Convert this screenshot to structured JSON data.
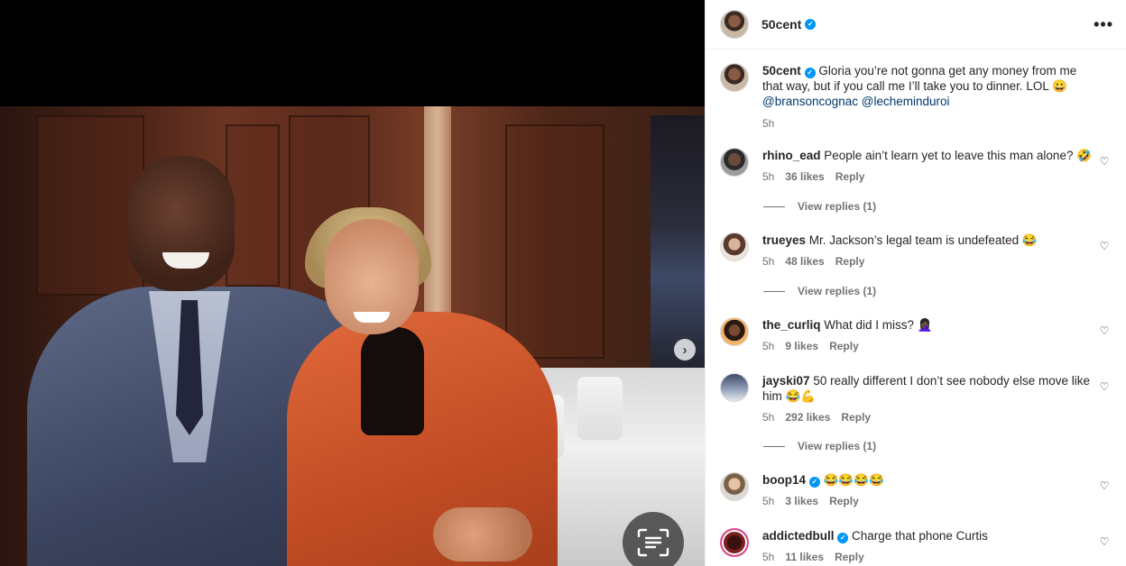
{
  "post": {
    "username": "50cent",
    "verified": true,
    "more_icon": "•••"
  },
  "media": {
    "next_icon": "›",
    "scan_icon": "visual-search-icon"
  },
  "caption": {
    "username": "50cent",
    "text": "Gloria you’re not gonna get any money from me that way, but if you call me I’ll take you to dinner. LOL 😀",
    "mentions": "@bransoncognac @lecheminduroi",
    "time": "5h"
  },
  "comments": [
    {
      "username": "rhino_ead",
      "verified": false,
      "text": "People ain’t learn yet to leave this man alone? 🤣",
      "time": "5h",
      "likes": "36 likes",
      "reply": "Reply",
      "view_replies": "View replies (1)"
    },
    {
      "username": "trueyes",
      "verified": false,
      "text": "Mr. Jackson’s legal team is undefeated 😂",
      "time": "5h",
      "likes": "48 likes",
      "reply": "Reply",
      "view_replies": "View replies (1)"
    },
    {
      "username": "the_curliq",
      "verified": false,
      "text": "What did I miss? 🤦🏿‍♀️",
      "time": "5h",
      "likes": "9 likes",
      "reply": "Reply"
    },
    {
      "username": "jayski07",
      "verified": false,
      "text": "50 really different I don’t see nobody else move like him 😂💪",
      "time": "5h",
      "likes": "292 likes",
      "reply": "Reply",
      "view_replies": "View replies (1)"
    },
    {
      "username": "boop14",
      "verified": true,
      "text": "😂😂😂😂",
      "time": "5h",
      "likes": "3 likes",
      "reply": "Reply"
    },
    {
      "username": "addictedbull",
      "verified": true,
      "text": "Charge that phone Curtis",
      "time": "5h",
      "likes": "11 likes",
      "reply": "Reply"
    }
  ],
  "icons": {
    "verified": "✓",
    "heart": "♡"
  },
  "colors": {
    "verified_blue": "#0095f6",
    "mention": "#00376b",
    "secondary_text": "#737373"
  }
}
